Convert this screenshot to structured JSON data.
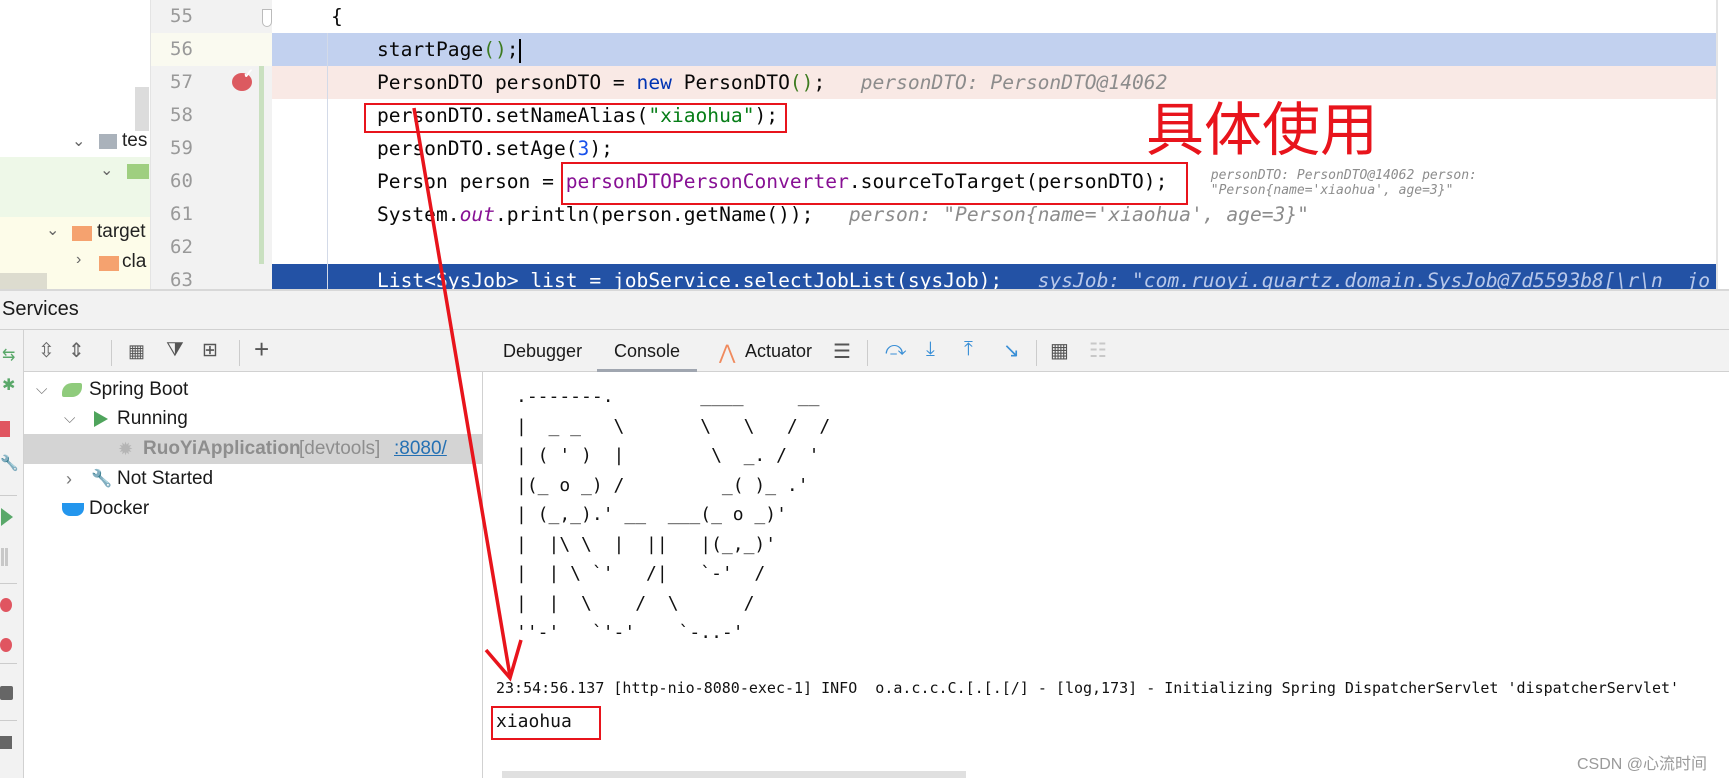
{
  "project_tree": {
    "items": [
      {
        "label": "tes",
        "icon": "folder-gray-icon"
      },
      {
        "label": "",
        "icon": "folder-green-icon"
      },
      {
        "label": "target",
        "icon": "folder-orange-icon"
      },
      {
        "label": "cla",
        "icon": "folder-orange-icon"
      }
    ]
  },
  "editor": {
    "lines": [
      {
        "num": "55",
        "segments": [
          {
            "t": "{",
            "c": ""
          }
        ]
      },
      {
        "num": "56",
        "segments": [
          {
            "t": "startPage",
            "c": ""
          },
          {
            "t": "()",
            "c": "c-paren"
          },
          {
            "t": ";",
            "c": ""
          }
        ]
      },
      {
        "num": "57",
        "segments": [
          {
            "t": "PersonDTO personDTO = ",
            "c": ""
          },
          {
            "t": "new",
            "c": "c-kw"
          },
          {
            "t": " PersonDTO",
            "c": ""
          },
          {
            "t": "()",
            "c": "c-paren"
          },
          {
            "t": ";   ",
            "c": ""
          },
          {
            "t": "personDTO: PersonDTO@14062",
            "c": "c-hint"
          }
        ]
      },
      {
        "num": "58",
        "segments": [
          {
            "t": "personDTO.setNameAlias(",
            "c": ""
          },
          {
            "t": "\"xiaohua\"",
            "c": "c-str"
          },
          {
            "t": ");",
            "c": ""
          }
        ]
      },
      {
        "num": "59",
        "segments": [
          {
            "t": "personDTO.setAge(",
            "c": ""
          },
          {
            "t": "3",
            "c": "c-num"
          },
          {
            "t": ");",
            "c": ""
          }
        ]
      },
      {
        "num": "60",
        "segments": [
          {
            "t": "Person person = ",
            "c": ""
          },
          {
            "t": "personDTOPersonConverter",
            "c": "c-field"
          },
          {
            "t": ".sourceToTarget(personDTO);   ",
            "c": ""
          },
          {
            "t": "personDTO: PersonDTO@14062    person: \"Person{name='xiaohua', age=3}\"",
            "c": "c-hint"
          }
        ]
      },
      {
        "num": "61",
        "segments": [
          {
            "t": "System.",
            "c": ""
          },
          {
            "t": "out",
            "c": "c-static"
          },
          {
            "t": ".println(person.getName());   ",
            "c": ""
          },
          {
            "t": "person: \"Person{name='xiaohua', age=3}\"",
            "c": "c-hint"
          }
        ]
      },
      {
        "num": "62",
        "segments": []
      },
      {
        "num": "63",
        "segments": [
          {
            "t": "List<SysJob> list = jobService.selectJobList(sysJob);   ",
            "c": ""
          },
          {
            "t": "sysJob: \"com.ruoyi.quartz.domain.SysJob@7d5593b8[\\r\\n  jo",
            "c": "c-hint"
          }
        ]
      }
    ]
  },
  "annotation": {
    "text": "具体使用",
    "color": "#e8141c"
  },
  "services": {
    "title": "Services",
    "tree": {
      "spring_boot": "Spring Boot",
      "running": "Running",
      "app_name": "RuoYiApplication",
      "app_tag": "[devtools]",
      "app_port": ":8080/",
      "not_started": "Not Started",
      "docker": "Docker"
    }
  },
  "debugger": {
    "tabs": [
      {
        "label": "Debugger",
        "active": false
      },
      {
        "label": "Console",
        "active": true
      },
      {
        "label": "Actuator",
        "active": false
      }
    ],
    "console_lines": [
      ".-------.        ____     __",
      "|  _ _   \\       \\   \\   /  /",
      "| ( ' )  |        \\  _. /  '",
      "|(_ o _) /         _( )_ .'",
      "| (_,_).' __  ___(_ o _)'",
      "|  |\\ \\  |  ||   |(_,_)'",
      "|  | \\ `'   /|   `-'  /",
      "|  |  \\    /  \\      /",
      "''-'   `'-'    `-..-'",
      "23:54:56.137 [http-nio-8080-exec-1] INFO  o.a.c.c.C.[.[.[/] - [log,173] - Initializing Spring DispatcherServlet 'dispatcherServlet'",
      "xiaohua"
    ]
  },
  "watermark": "CSDN @心流时间",
  "colors": {
    "accent_red": "#e8141c",
    "selection": "#c2d1ef",
    "breakpoint_line": "#f9e9e5",
    "current_line": "#2352a5",
    "link": "#2470b3"
  }
}
